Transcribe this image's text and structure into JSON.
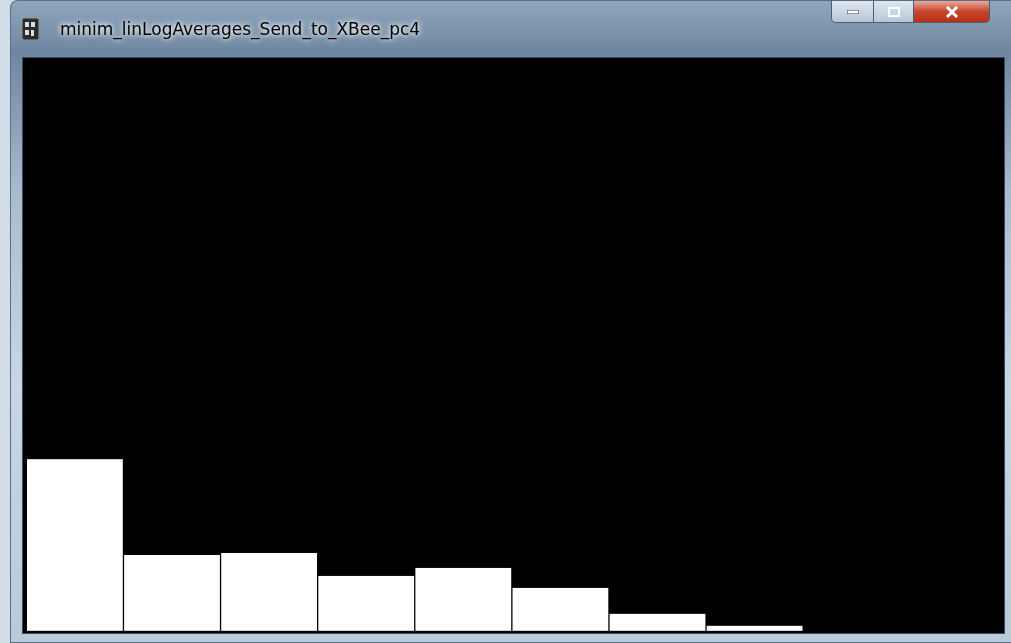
{
  "window": {
    "title": "minim_linLogAverages_Send_to_XBee_pc4"
  }
}
